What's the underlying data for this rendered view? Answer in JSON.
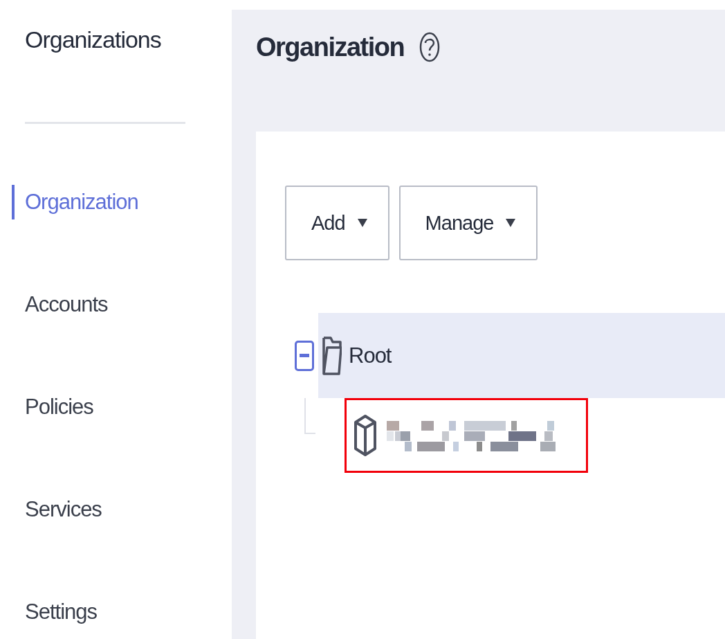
{
  "sidebar": {
    "title": "Organizations",
    "items": [
      {
        "label": "Organization",
        "selected": true
      },
      {
        "label": "Accounts",
        "selected": false
      },
      {
        "label": "Policies",
        "selected": false
      },
      {
        "label": "Services",
        "selected": false
      },
      {
        "label": "Settings",
        "selected": false
      }
    ]
  },
  "header": {
    "title": "Organization"
  },
  "toolbar": {
    "buttons": [
      {
        "label": "Add"
      },
      {
        "label": "Manage"
      }
    ]
  },
  "tree": [
    {
      "label": "Root",
      "kind": "folder",
      "expanded": true,
      "selected": true,
      "children": [
        {
          "kind": "account",
          "highlighted": true
        }
      ]
    }
  ]
}
